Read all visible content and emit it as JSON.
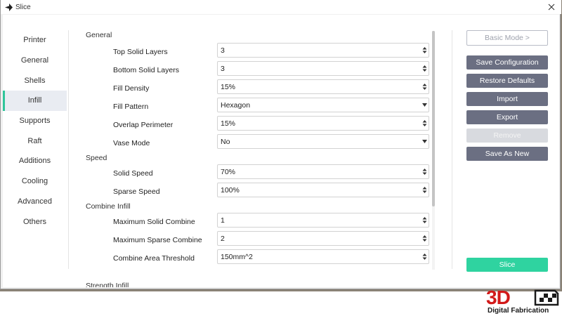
{
  "window": {
    "title": "Slice"
  },
  "nav": {
    "items": [
      {
        "label": "Printer"
      },
      {
        "label": "General"
      },
      {
        "label": "Shells"
      },
      {
        "label": "Infill"
      },
      {
        "label": "Supports"
      },
      {
        "label": "Raft"
      },
      {
        "label": "Additions"
      },
      {
        "label": "Cooling"
      },
      {
        "label": "Advanced"
      },
      {
        "label": "Others"
      }
    ],
    "active": "Infill"
  },
  "sections": {
    "general": {
      "title": "General",
      "rows": [
        {
          "label": "Top Solid Layers",
          "value": "3",
          "control": "spinbox"
        },
        {
          "label": "Bottom Solid Layers",
          "value": "3",
          "control": "spinbox"
        },
        {
          "label": "Fill Density",
          "value": "15%",
          "control": "spinbox"
        },
        {
          "label": "Fill Pattern",
          "value": "Hexagon",
          "control": "dropdown"
        },
        {
          "label": "Overlap Perimeter",
          "value": "15%",
          "control": "spinbox"
        },
        {
          "label": "Vase Mode",
          "value": "No",
          "control": "dropdown"
        }
      ]
    },
    "speed": {
      "title": "Speed",
      "rows": [
        {
          "label": "Solid Speed",
          "value": "70%",
          "control": "spinbox"
        },
        {
          "label": "Sparse Speed",
          "value": "100%",
          "control": "spinbox"
        }
      ]
    },
    "combine": {
      "title": "Combine Infill",
      "rows": [
        {
          "label": "Maximum Solid Combine",
          "value": "1",
          "control": "spinbox"
        },
        {
          "label": "Maximum Sparse Combine",
          "value": "2",
          "control": "spinbox"
        },
        {
          "label": "Combine Area Threshold",
          "value": "150mm^2",
          "control": "spinbox"
        }
      ]
    },
    "strength": {
      "title": "Strength Infill"
    }
  },
  "side": {
    "basic_mode": "Basic Mode >",
    "save_config": "Save Configuration",
    "restore_defaults": "Restore Defaults",
    "import": "Import",
    "export": "Export",
    "remove": "Remove",
    "save_as_new": "Save As New",
    "slice": "Slice"
  },
  "watermark": {
    "brand": "3D",
    "tagline": "Digital Fabrication"
  },
  "colors": {
    "accent": "#2fd3a0",
    "button": "#6b6f82",
    "watermark_red": "#d21919"
  }
}
